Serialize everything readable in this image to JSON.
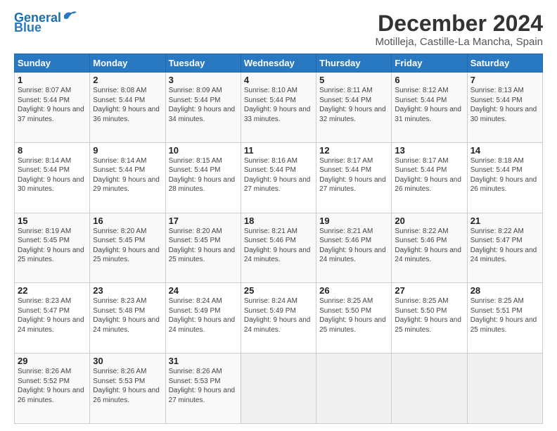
{
  "header": {
    "logo_line1": "General",
    "logo_line2": "Blue",
    "month_title": "December 2024",
    "location": "Motilleja, Castille-La Mancha, Spain"
  },
  "days_of_week": [
    "Sunday",
    "Monday",
    "Tuesday",
    "Wednesday",
    "Thursday",
    "Friday",
    "Saturday"
  ],
  "weeks": [
    [
      {
        "day": "1",
        "sunrise": "Sunrise: 8:07 AM",
        "sunset": "Sunset: 5:44 PM",
        "daylight": "Daylight: 9 hours and 37 minutes."
      },
      {
        "day": "2",
        "sunrise": "Sunrise: 8:08 AM",
        "sunset": "Sunset: 5:44 PM",
        "daylight": "Daylight: 9 hours and 36 minutes."
      },
      {
        "day": "3",
        "sunrise": "Sunrise: 8:09 AM",
        "sunset": "Sunset: 5:44 PM",
        "daylight": "Daylight: 9 hours and 34 minutes."
      },
      {
        "day": "4",
        "sunrise": "Sunrise: 8:10 AM",
        "sunset": "Sunset: 5:44 PM",
        "daylight": "Daylight: 9 hours and 33 minutes."
      },
      {
        "day": "5",
        "sunrise": "Sunrise: 8:11 AM",
        "sunset": "Sunset: 5:44 PM",
        "daylight": "Daylight: 9 hours and 32 minutes."
      },
      {
        "day": "6",
        "sunrise": "Sunrise: 8:12 AM",
        "sunset": "Sunset: 5:44 PM",
        "daylight": "Daylight: 9 hours and 31 minutes."
      },
      {
        "day": "7",
        "sunrise": "Sunrise: 8:13 AM",
        "sunset": "Sunset: 5:44 PM",
        "daylight": "Daylight: 9 hours and 30 minutes."
      }
    ],
    [
      {
        "day": "8",
        "sunrise": "Sunrise: 8:14 AM",
        "sunset": "Sunset: 5:44 PM",
        "daylight": "Daylight: 9 hours and 30 minutes."
      },
      {
        "day": "9",
        "sunrise": "Sunrise: 8:14 AM",
        "sunset": "Sunset: 5:44 PM",
        "daylight": "Daylight: 9 hours and 29 minutes."
      },
      {
        "day": "10",
        "sunrise": "Sunrise: 8:15 AM",
        "sunset": "Sunset: 5:44 PM",
        "daylight": "Daylight: 9 hours and 28 minutes."
      },
      {
        "day": "11",
        "sunrise": "Sunrise: 8:16 AM",
        "sunset": "Sunset: 5:44 PM",
        "daylight": "Daylight: 9 hours and 27 minutes."
      },
      {
        "day": "12",
        "sunrise": "Sunrise: 8:17 AM",
        "sunset": "Sunset: 5:44 PM",
        "daylight": "Daylight: 9 hours and 27 minutes."
      },
      {
        "day": "13",
        "sunrise": "Sunrise: 8:17 AM",
        "sunset": "Sunset: 5:44 PM",
        "daylight": "Daylight: 9 hours and 26 minutes."
      },
      {
        "day": "14",
        "sunrise": "Sunrise: 8:18 AM",
        "sunset": "Sunset: 5:44 PM",
        "daylight": "Daylight: 9 hours and 26 minutes."
      }
    ],
    [
      {
        "day": "15",
        "sunrise": "Sunrise: 8:19 AM",
        "sunset": "Sunset: 5:45 PM",
        "daylight": "Daylight: 9 hours and 25 minutes."
      },
      {
        "day": "16",
        "sunrise": "Sunrise: 8:20 AM",
        "sunset": "Sunset: 5:45 PM",
        "daylight": "Daylight: 9 hours and 25 minutes."
      },
      {
        "day": "17",
        "sunrise": "Sunrise: 8:20 AM",
        "sunset": "Sunset: 5:45 PM",
        "daylight": "Daylight: 9 hours and 25 minutes."
      },
      {
        "day": "18",
        "sunrise": "Sunrise: 8:21 AM",
        "sunset": "Sunset: 5:46 PM",
        "daylight": "Daylight: 9 hours and 24 minutes."
      },
      {
        "day": "19",
        "sunrise": "Sunrise: 8:21 AM",
        "sunset": "Sunset: 5:46 PM",
        "daylight": "Daylight: 9 hours and 24 minutes."
      },
      {
        "day": "20",
        "sunrise": "Sunrise: 8:22 AM",
        "sunset": "Sunset: 5:46 PM",
        "daylight": "Daylight: 9 hours and 24 minutes."
      },
      {
        "day": "21",
        "sunrise": "Sunrise: 8:22 AM",
        "sunset": "Sunset: 5:47 PM",
        "daylight": "Daylight: 9 hours and 24 minutes."
      }
    ],
    [
      {
        "day": "22",
        "sunrise": "Sunrise: 8:23 AM",
        "sunset": "Sunset: 5:47 PM",
        "daylight": "Daylight: 9 hours and 24 minutes."
      },
      {
        "day": "23",
        "sunrise": "Sunrise: 8:23 AM",
        "sunset": "Sunset: 5:48 PM",
        "daylight": "Daylight: 9 hours and 24 minutes."
      },
      {
        "day": "24",
        "sunrise": "Sunrise: 8:24 AM",
        "sunset": "Sunset: 5:49 PM",
        "daylight": "Daylight: 9 hours and 24 minutes."
      },
      {
        "day": "25",
        "sunrise": "Sunrise: 8:24 AM",
        "sunset": "Sunset: 5:49 PM",
        "daylight": "Daylight: 9 hours and 24 minutes."
      },
      {
        "day": "26",
        "sunrise": "Sunrise: 8:25 AM",
        "sunset": "Sunset: 5:50 PM",
        "daylight": "Daylight: 9 hours and 25 minutes."
      },
      {
        "day": "27",
        "sunrise": "Sunrise: 8:25 AM",
        "sunset": "Sunset: 5:50 PM",
        "daylight": "Daylight: 9 hours and 25 minutes."
      },
      {
        "day": "28",
        "sunrise": "Sunrise: 8:25 AM",
        "sunset": "Sunset: 5:51 PM",
        "daylight": "Daylight: 9 hours and 25 minutes."
      }
    ],
    [
      {
        "day": "29",
        "sunrise": "Sunrise: 8:26 AM",
        "sunset": "Sunset: 5:52 PM",
        "daylight": "Daylight: 9 hours and 26 minutes."
      },
      {
        "day": "30",
        "sunrise": "Sunrise: 8:26 AM",
        "sunset": "Sunset: 5:53 PM",
        "daylight": "Daylight: 9 hours and 26 minutes."
      },
      {
        "day": "31",
        "sunrise": "Sunrise: 8:26 AM",
        "sunset": "Sunset: 5:53 PM",
        "daylight": "Daylight: 9 hours and 27 minutes."
      },
      null,
      null,
      null,
      null
    ]
  ]
}
